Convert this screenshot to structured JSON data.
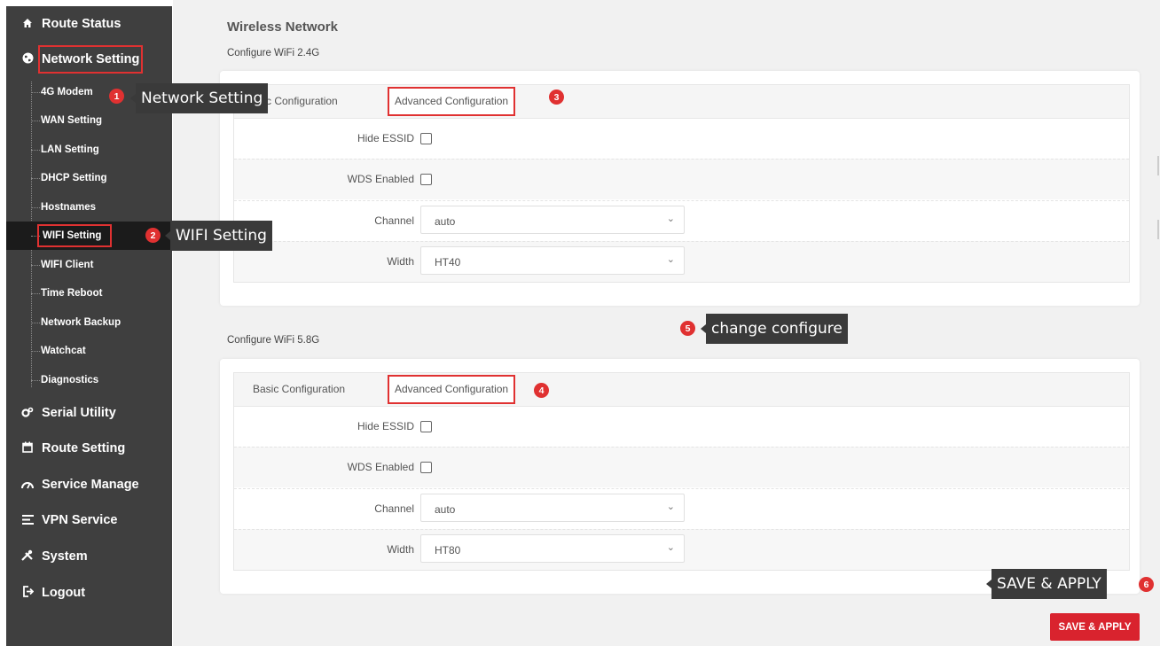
{
  "sidebar": {
    "top_items": [
      {
        "label": "Route Status",
        "icon": "home-icon"
      },
      {
        "label": "Network Setting",
        "icon": "globe-icon"
      },
      {
        "label": "Serial Utility",
        "icon": "gears-icon"
      },
      {
        "label": "Route Setting",
        "icon": "calendar-icon"
      },
      {
        "label": "Service Manage",
        "icon": "gauge-icon"
      },
      {
        "label": "VPN Service",
        "icon": "list-icon"
      },
      {
        "label": "System",
        "icon": "tools-icon"
      },
      {
        "label": "Logout",
        "icon": "logout-icon"
      }
    ],
    "sub_items": [
      "4G Modem",
      "WAN Setting",
      "LAN Setting",
      "DHCP Setting",
      "Hostnames",
      "WIFI Setting",
      "WIFI Client",
      "Time Reboot",
      "Network Backup",
      "Watchcat",
      "Diagnostics"
    ],
    "active_sub_item": "WIFI Setting"
  },
  "annotations": {
    "network_setting": {
      "badge": "1",
      "text": "Network Setting"
    },
    "wifi_setting": {
      "badge": "2",
      "text": "WIFI Setting"
    },
    "adv_24": {
      "badge": "3"
    },
    "adv_58": {
      "badge": "4"
    },
    "change_configure": {
      "badge": "5",
      "text": "change configure"
    },
    "save_apply": {
      "badge": "6",
      "text": "SAVE & APPLY"
    }
  },
  "main": {
    "page_title": "Wireless Network",
    "wifi24": {
      "title": "Configure WiFi 2.4G",
      "tabs": {
        "basic": "Basic Configuration",
        "basic_visible": "c Configuration",
        "advanced": "Advanced Configuration"
      },
      "hide_essid_label": "Hide ESSID",
      "wds_label": "WDS Enabled",
      "channel_label": "Channel",
      "channel_value": "auto",
      "width_label": "Width",
      "width_value": "HT40"
    },
    "wifi58": {
      "title": "Configure WiFi 5.8G",
      "tabs": {
        "basic": "Basic Configuration",
        "advanced": "Advanced Configuration"
      },
      "hide_essid_label": "Hide ESSID",
      "wds_label": "WDS Enabled",
      "channel_label": "Channel",
      "channel_value": "auto",
      "width_label": "Width",
      "width_value": "HT80"
    },
    "save_button": "SAVE & APPLY"
  },
  "colors": {
    "sidebar_bg": "#3f3f3f",
    "active_bg": "#1b1b1b",
    "accent_red": "#d9232e",
    "callout_bg": "#3a3a3a",
    "content_bg": "#f1f1f1"
  }
}
